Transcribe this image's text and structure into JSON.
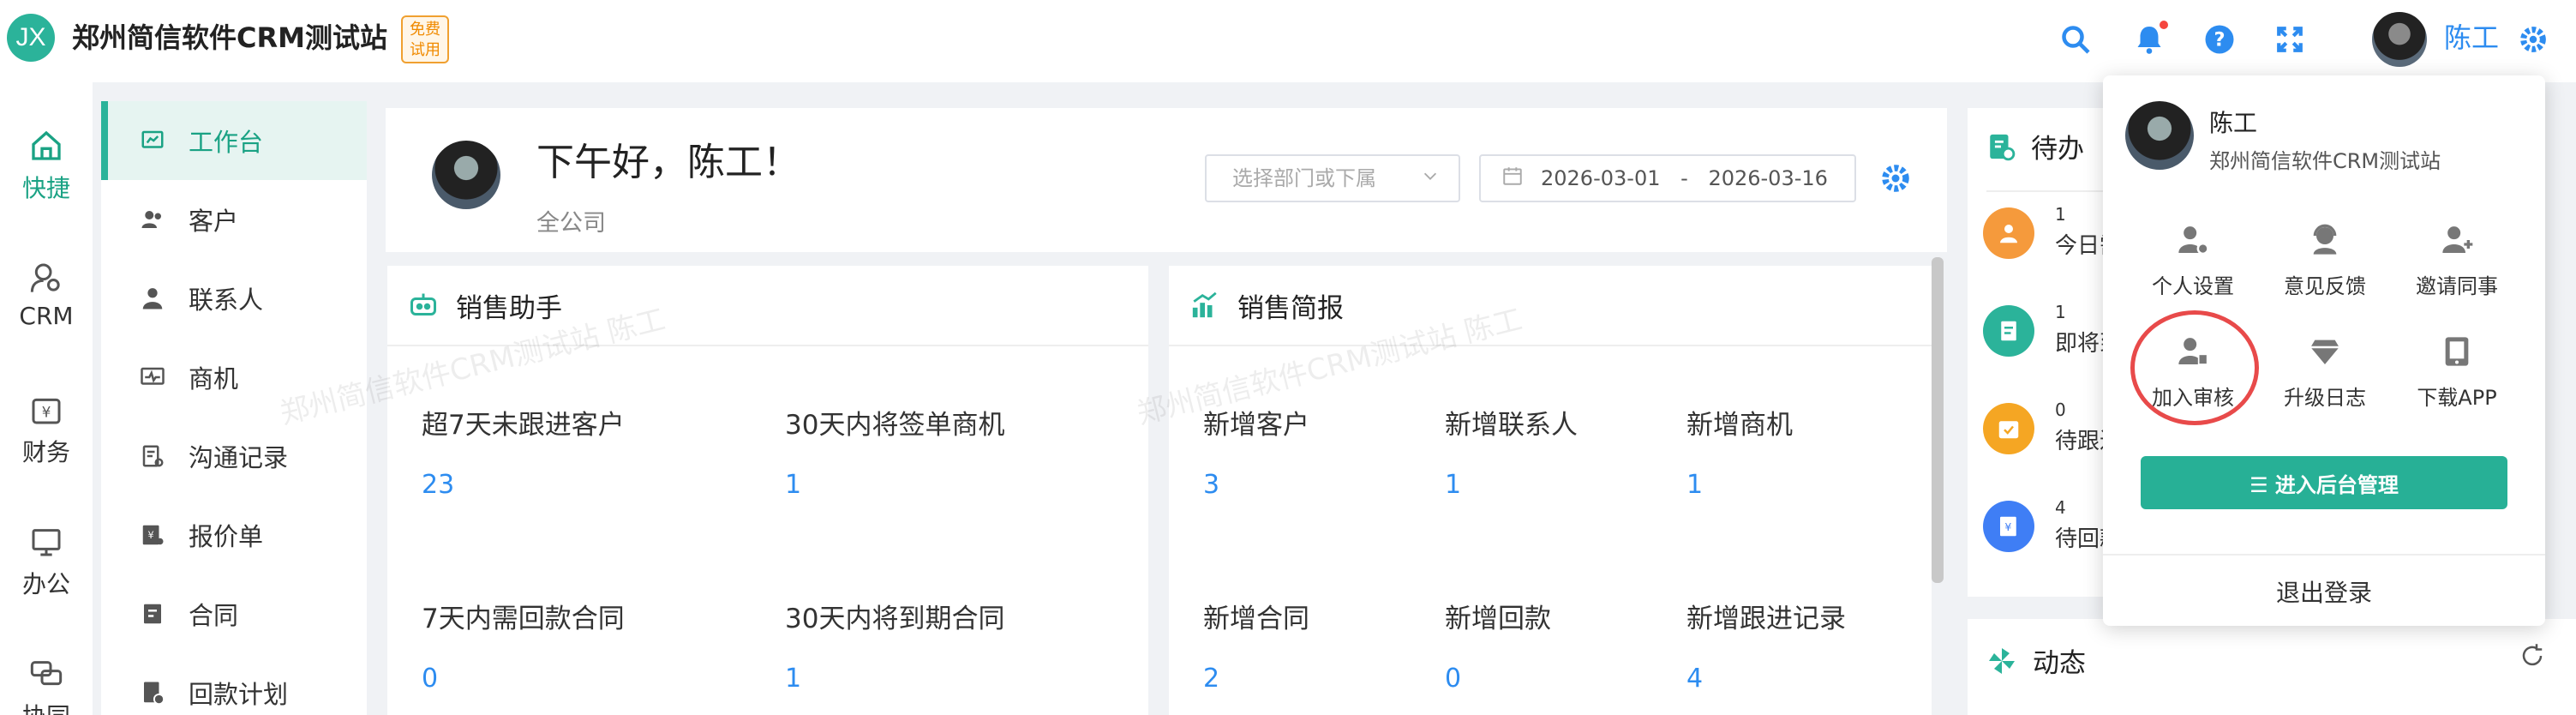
{
  "app": {
    "logo_text": "JX",
    "title": "郑州简信软件CRM测试站",
    "badge": "免费试用",
    "user_name": "陈工"
  },
  "rail": [
    {
      "label": "快捷",
      "icon": "home-icon",
      "active": true
    },
    {
      "label": "CRM",
      "icon": "crm-user-icon"
    },
    {
      "label": "财务",
      "icon": "finance-icon"
    },
    {
      "label": "办公",
      "icon": "office-icon"
    },
    {
      "label": "协同",
      "icon": "collab-icon"
    }
  ],
  "subnav": [
    {
      "label": "工作台",
      "icon": "dashboard-icon",
      "active": true
    },
    {
      "label": "客户",
      "icon": "customers-icon"
    },
    {
      "label": "联系人",
      "icon": "contact-icon"
    },
    {
      "label": "商机",
      "icon": "opportunity-icon"
    },
    {
      "label": "沟通记录",
      "icon": "communication-icon"
    },
    {
      "label": "报价单",
      "icon": "quote-icon"
    },
    {
      "label": "合同",
      "icon": "contract-icon"
    },
    {
      "label": "回款计划",
      "icon": "payment-plan-icon"
    }
  ],
  "greeting": {
    "title": "下午好，陈工！",
    "scope": "全公司",
    "dept_placeholder": "选择部门或下属",
    "date_start": "2026-03-01",
    "date_sep": "-",
    "date_end": "2026-03-16"
  },
  "sales_assistant": {
    "title": "销售助手",
    "stats": [
      {
        "label": "超7天未跟进客户",
        "value": "23"
      },
      {
        "label": "30天内将签单商机",
        "value": "1"
      },
      {
        "label": "7天内需回款合同",
        "value": "0"
      },
      {
        "label": "30天内将到期合同",
        "value": "1"
      }
    ]
  },
  "sales_brief": {
    "title": "销售简报",
    "stats": [
      {
        "label": "新增客户",
        "value": "3"
      },
      {
        "label": "新增联系人",
        "value": "1"
      },
      {
        "label": "新增商机",
        "value": "1"
      },
      {
        "label": "新增合同",
        "value": "2"
      },
      {
        "label": "新增回款",
        "value": "0"
      },
      {
        "label": "新增跟进记录",
        "value": "4"
      }
    ]
  },
  "todo": {
    "title": "待办",
    "items": [
      {
        "count": "1",
        "label": "今日需",
        "color": "#f59a3c"
      },
      {
        "count": "1",
        "label": "即将到",
        "color": "#2bb39a"
      },
      {
        "count": "0",
        "label": "待跟进",
        "color": "#f5a623"
      },
      {
        "count": "4",
        "label": "待回款",
        "color": "#3f7ef5"
      }
    ]
  },
  "dynamics": {
    "title": "动态"
  },
  "watermark": "郑州简信软件CRM测试站 陈工",
  "dropdown": {
    "name": "陈工",
    "org": "郑州简信软件CRM测试站",
    "grid": [
      {
        "label": "个人设置",
        "icon": "user-settings-icon"
      },
      {
        "label": "意见反馈",
        "icon": "feedback-icon"
      },
      {
        "label": "邀请同事",
        "icon": "invite-icon"
      },
      {
        "label": "加入审核",
        "icon": "join-review-icon"
      },
      {
        "label": "升级日志",
        "icon": "upgrade-log-icon"
      },
      {
        "label": "下载APP",
        "icon": "download-app-icon"
      }
    ],
    "admin_button": "☰ 进入后台管理",
    "logout": "退出登录"
  },
  "colors": {
    "accent": "#2bb39a",
    "link": "#2d8cf0",
    "highlight_circle": "#e84a4a"
  }
}
